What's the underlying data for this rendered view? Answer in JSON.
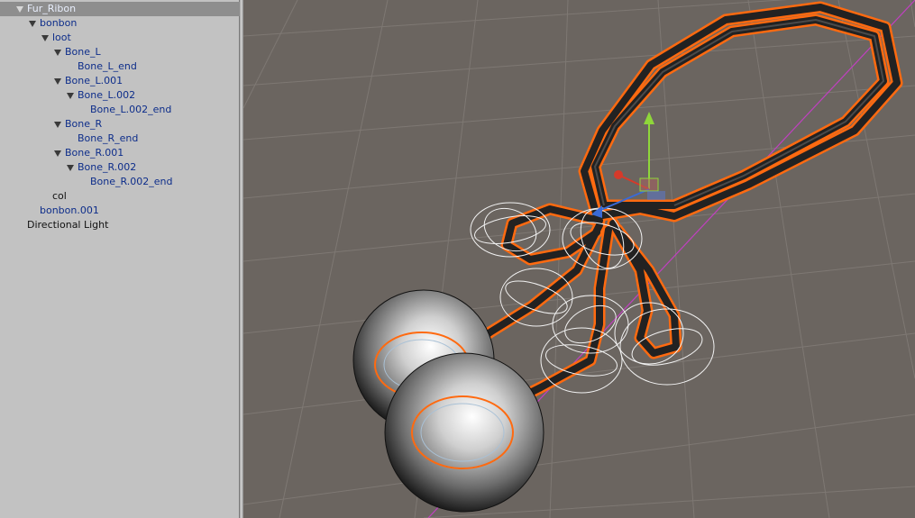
{
  "hierarchy": {
    "items": [
      {
        "label": "Fur_Ribon",
        "expanded": true,
        "selected": true
      },
      {
        "label": "bonbon",
        "expanded": true
      },
      {
        "label": "loot",
        "expanded": true
      },
      {
        "label": "Bone_L",
        "expanded": true
      },
      {
        "label": "Bone_L_end"
      },
      {
        "label": "Bone_L.001",
        "expanded": true
      },
      {
        "label": "Bone_L.002",
        "expanded": true
      },
      {
        "label": "Bone_L.002_end"
      },
      {
        "label": "Bone_R",
        "expanded": true
      },
      {
        "label": "Bone_R_end"
      },
      {
        "label": "Bone_R.001",
        "expanded": true
      },
      {
        "label": "Bone_R.002",
        "expanded": true
      },
      {
        "label": "Bone_R.002_end"
      },
      {
        "label": "col"
      },
      {
        "label": "bonbon.001"
      },
      {
        "label": "Directional Light"
      }
    ]
  },
  "scene": {
    "colors": {
      "background": "#6b6560",
      "grid": "#7e7873",
      "selection_outline": "#ff6a10",
      "ribbon": "#222222",
      "gizmo_y": "#8fd63a",
      "gizmo_x": "#d63a2a",
      "gizmo_z": "#3a6ad6",
      "bounds_line": "#c040c0",
      "wire_spheres": "#f2f2f2"
    },
    "icons": [
      "transform-gizmo-icon"
    ]
  }
}
